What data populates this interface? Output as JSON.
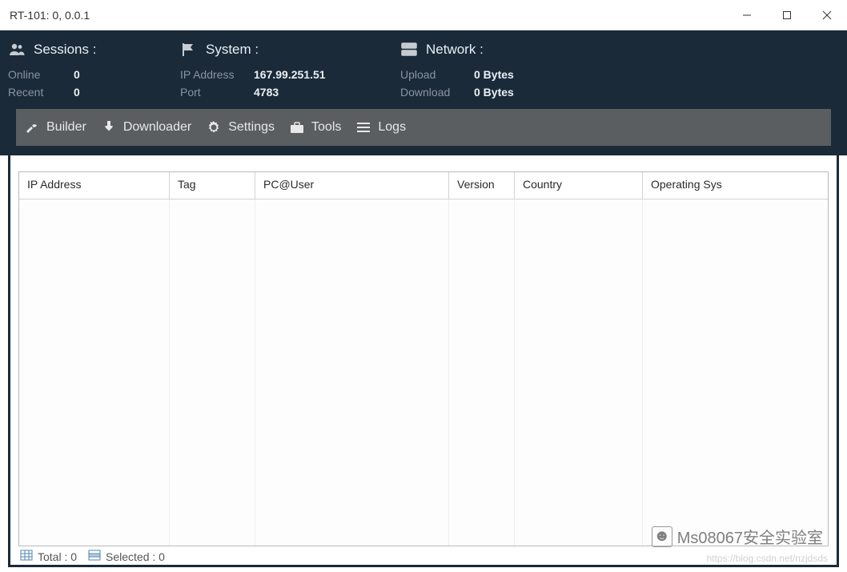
{
  "window": {
    "title": "RT-101: 0, 0.0.1"
  },
  "info": {
    "sessions": {
      "heading": "Sessions :",
      "online_label": "Online",
      "online_value": "0",
      "recent_label": "Recent",
      "recent_value": "0"
    },
    "system": {
      "heading": "System :",
      "ip_label": "IP Address",
      "ip_value": "167.99.251.51",
      "port_label": "Port",
      "port_value": "4783"
    },
    "network": {
      "heading": "Network :",
      "upload_label": "Upload",
      "upload_value": "0 Bytes",
      "download_label": "Download",
      "download_value": "0 Bytes"
    }
  },
  "toolbar": {
    "builder": "Builder",
    "downloader": "Downloader",
    "settings": "Settings",
    "tools": "Tools",
    "logs": "Logs"
  },
  "table": {
    "columns": {
      "ip": "IP Address",
      "tag": "Tag",
      "pcuser": "PC@User",
      "version": "Version",
      "country": "Country",
      "os": "Operating Sys"
    },
    "rows": []
  },
  "status": {
    "total": "Total : 0",
    "selected": "Selected : 0"
  },
  "watermark": {
    "text": "Ms08067安全实验室",
    "url": "https://blog.csdn.net/nzjdsds"
  }
}
